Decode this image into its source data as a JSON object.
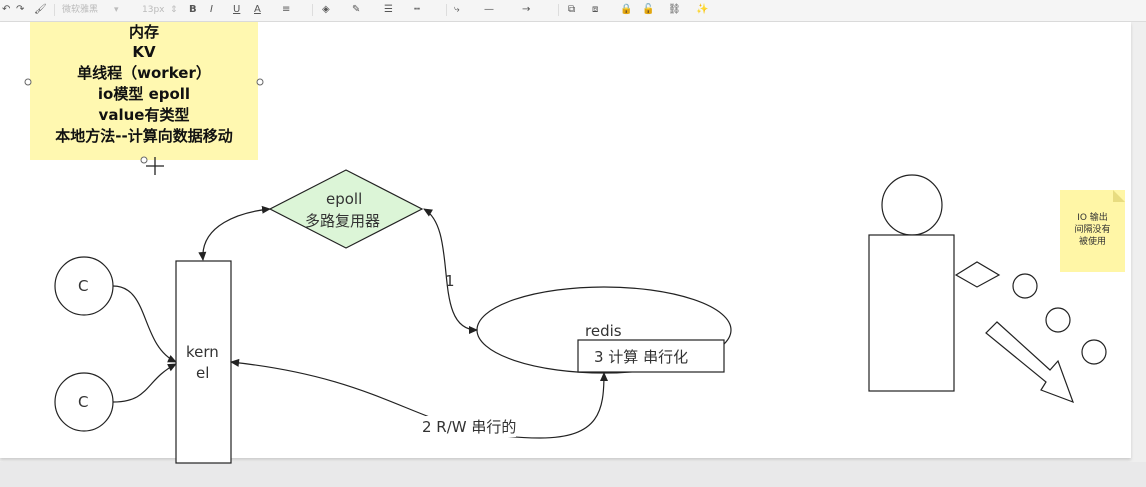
{
  "toolbar": {
    "font_family": "微软雅黑",
    "font_size": "13px",
    "bold": "B",
    "italic": "I",
    "underline": "U",
    "font_color": "A"
  },
  "note": {
    "lines": [
      "内存",
      "KV",
      "单线程（worker）",
      "io模型  epoll",
      "value有类型",
      "本地方法--计算向数据移动"
    ]
  },
  "diagram": {
    "client1": "C",
    "client2": "C",
    "kernel_line1": "kern",
    "kernel_line2": "el",
    "epoll_line1": "epoll",
    "epoll_line2": "多路复用器",
    "edge1_label": "1",
    "redis_label": "redis",
    "compute_label": "3  计算  串行化",
    "edge2_label": "2 R/W 串行的"
  },
  "small_note": {
    "lines": [
      "IO  输出",
      "间隔没有",
      "被使用"
    ]
  },
  "colors": {
    "note_bg": "#fff8b0",
    "epoll_fill": "#dcf5d7",
    "canvas": "#ffffff"
  }
}
